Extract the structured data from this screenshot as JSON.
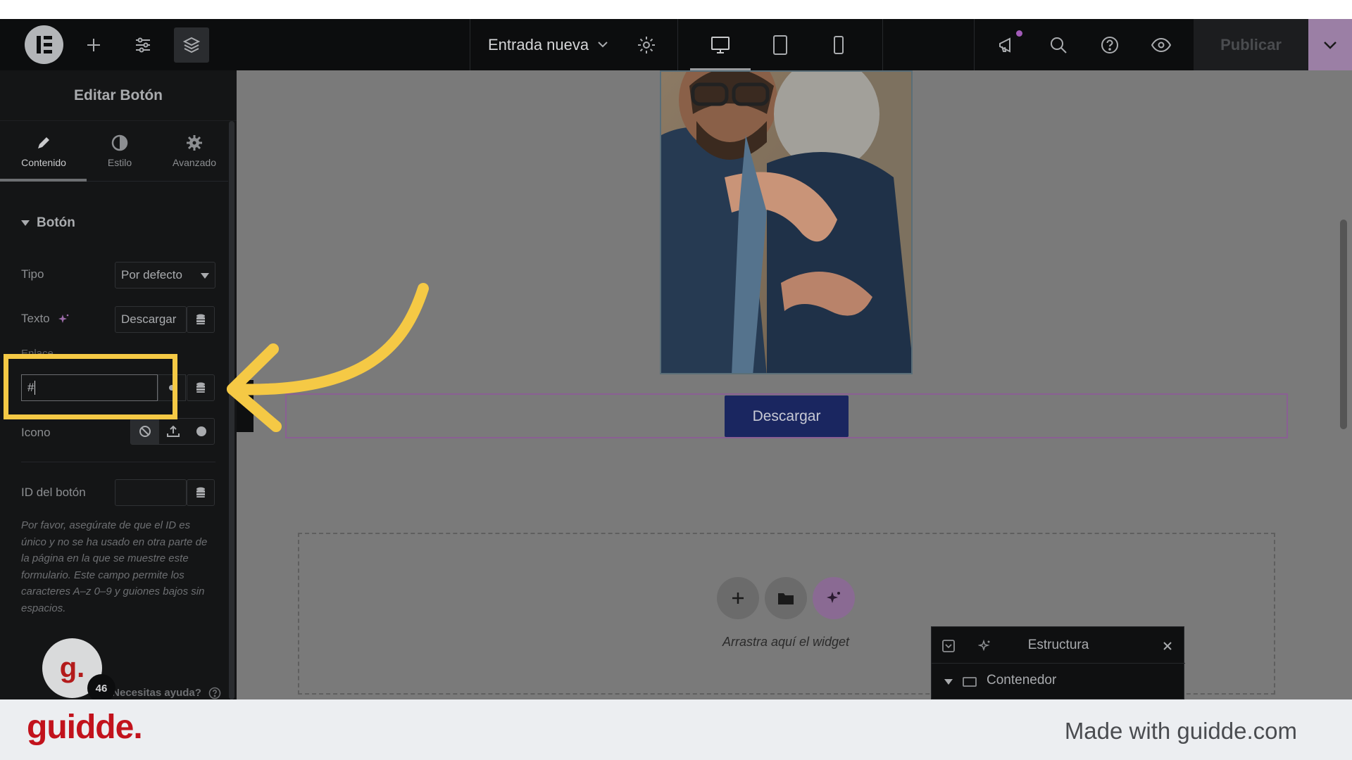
{
  "topbar": {
    "document_title": "Entrada nueva",
    "publish_label": "Publicar"
  },
  "panel": {
    "title": "Editar Botón",
    "tabs": [
      {
        "label": "Contenido",
        "icon": "pencil-icon"
      },
      {
        "label": "Estilo",
        "icon": "half-circle-icon"
      },
      {
        "label": "Avanzado",
        "icon": "gear-icon"
      }
    ],
    "section": "Botón",
    "fields": {
      "tipo_label": "Tipo",
      "tipo_value": "Por defecto",
      "texto_label": "Texto",
      "texto_value": "Descargar",
      "enlace_label": "Enlace",
      "enlace_value": "#",
      "icono_label": "Icono",
      "id_label": "ID del botón",
      "id_value": ""
    },
    "help_note": "Por favor, asegúrate de que el ID es único y no se ha usado en otra parte de la página en la que se muestre este formulario. Este campo permite los caracteres A–z  0–9 y guiones bajos sin espacios.",
    "help_link": "¿Necesitas ayuda?",
    "avatar_letter": "g.",
    "badge_count": "46"
  },
  "canvas": {
    "button_label": "Descargar",
    "dropzone_text": "Arrastra aquí el widget"
  },
  "structure": {
    "title": "Estructura",
    "item": "Contenedor"
  },
  "footer": {
    "brand": "guidde.",
    "made_with": "Made with guidde.com"
  },
  "colors": {
    "highlight": "#f5c945",
    "accent_purple": "#9b7fa5",
    "button_navy": "#1a2660",
    "brand_red": "#c2121c"
  }
}
